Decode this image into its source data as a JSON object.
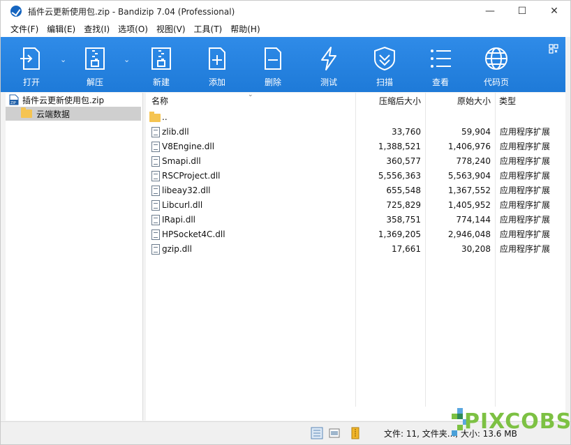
{
  "window": {
    "title": "插件云更新使用包.zip - Bandizip 7.04 (Professional)",
    "controls": {
      "minimize": "—",
      "maximize": "☐",
      "close": "✕"
    }
  },
  "menu": [
    "文件(F)",
    "编辑(E)",
    "查找(I)",
    "选项(O)",
    "视图(V)",
    "工具(T)",
    "帮助(H)"
  ],
  "toolbar": {
    "accent": "#2585e3",
    "buttons": [
      {
        "label": "打开",
        "icon": "open-icon"
      },
      {
        "label": "解压",
        "icon": "extract-icon"
      },
      {
        "label": "新建",
        "icon": "new-archive-icon"
      },
      {
        "label": "添加",
        "icon": "add-icon"
      },
      {
        "label": "删除",
        "icon": "delete-icon"
      },
      {
        "label": "测试",
        "icon": "test-icon"
      },
      {
        "label": "扫描",
        "icon": "scan-icon"
      },
      {
        "label": "查看",
        "icon": "view-icon"
      },
      {
        "label": "代码页",
        "icon": "codepage-icon"
      }
    ]
  },
  "tree": {
    "root": "插件云更新使用包.zip",
    "child": "云端数据"
  },
  "table": {
    "headers": {
      "name": "名称",
      "compressed": "压缩后大小",
      "original": "原始大小",
      "type": "类型"
    },
    "parent": "..",
    "rows": [
      {
        "name": "zlib.dll",
        "compressed": "33,760",
        "original": "59,904",
        "type": "应用程序扩展"
      },
      {
        "name": "V8Engine.dll",
        "compressed": "1,388,521",
        "original": "1,406,976",
        "type": "应用程序扩展"
      },
      {
        "name": "Smapi.dll",
        "compressed": "360,577",
        "original": "778,240",
        "type": "应用程序扩展"
      },
      {
        "name": "RSCProject.dll",
        "compressed": "5,556,363",
        "original": "5,563,904",
        "type": "应用程序扩展"
      },
      {
        "name": "libeay32.dll",
        "compressed": "655,548",
        "original": "1,367,552",
        "type": "应用程序扩展"
      },
      {
        "name": "Libcurl.dll",
        "compressed": "725,829",
        "original": "1,405,952",
        "type": "应用程序扩展"
      },
      {
        "name": "IRapi.dll",
        "compressed": "358,751",
        "original": "774,144",
        "type": "应用程序扩展"
      },
      {
        "name": "HPSocket4C.dll",
        "compressed": "1,369,205",
        "original": "2,946,048",
        "type": "应用程序扩展"
      },
      {
        "name": "gzip.dll",
        "compressed": "17,661",
        "original": "30,208",
        "type": "应用程序扩展"
      }
    ]
  },
  "status": {
    "text": "文件: 11, 文件夹..., 大小: 13.6 MB"
  },
  "watermark": {
    "text": "PIXCOBS"
  }
}
